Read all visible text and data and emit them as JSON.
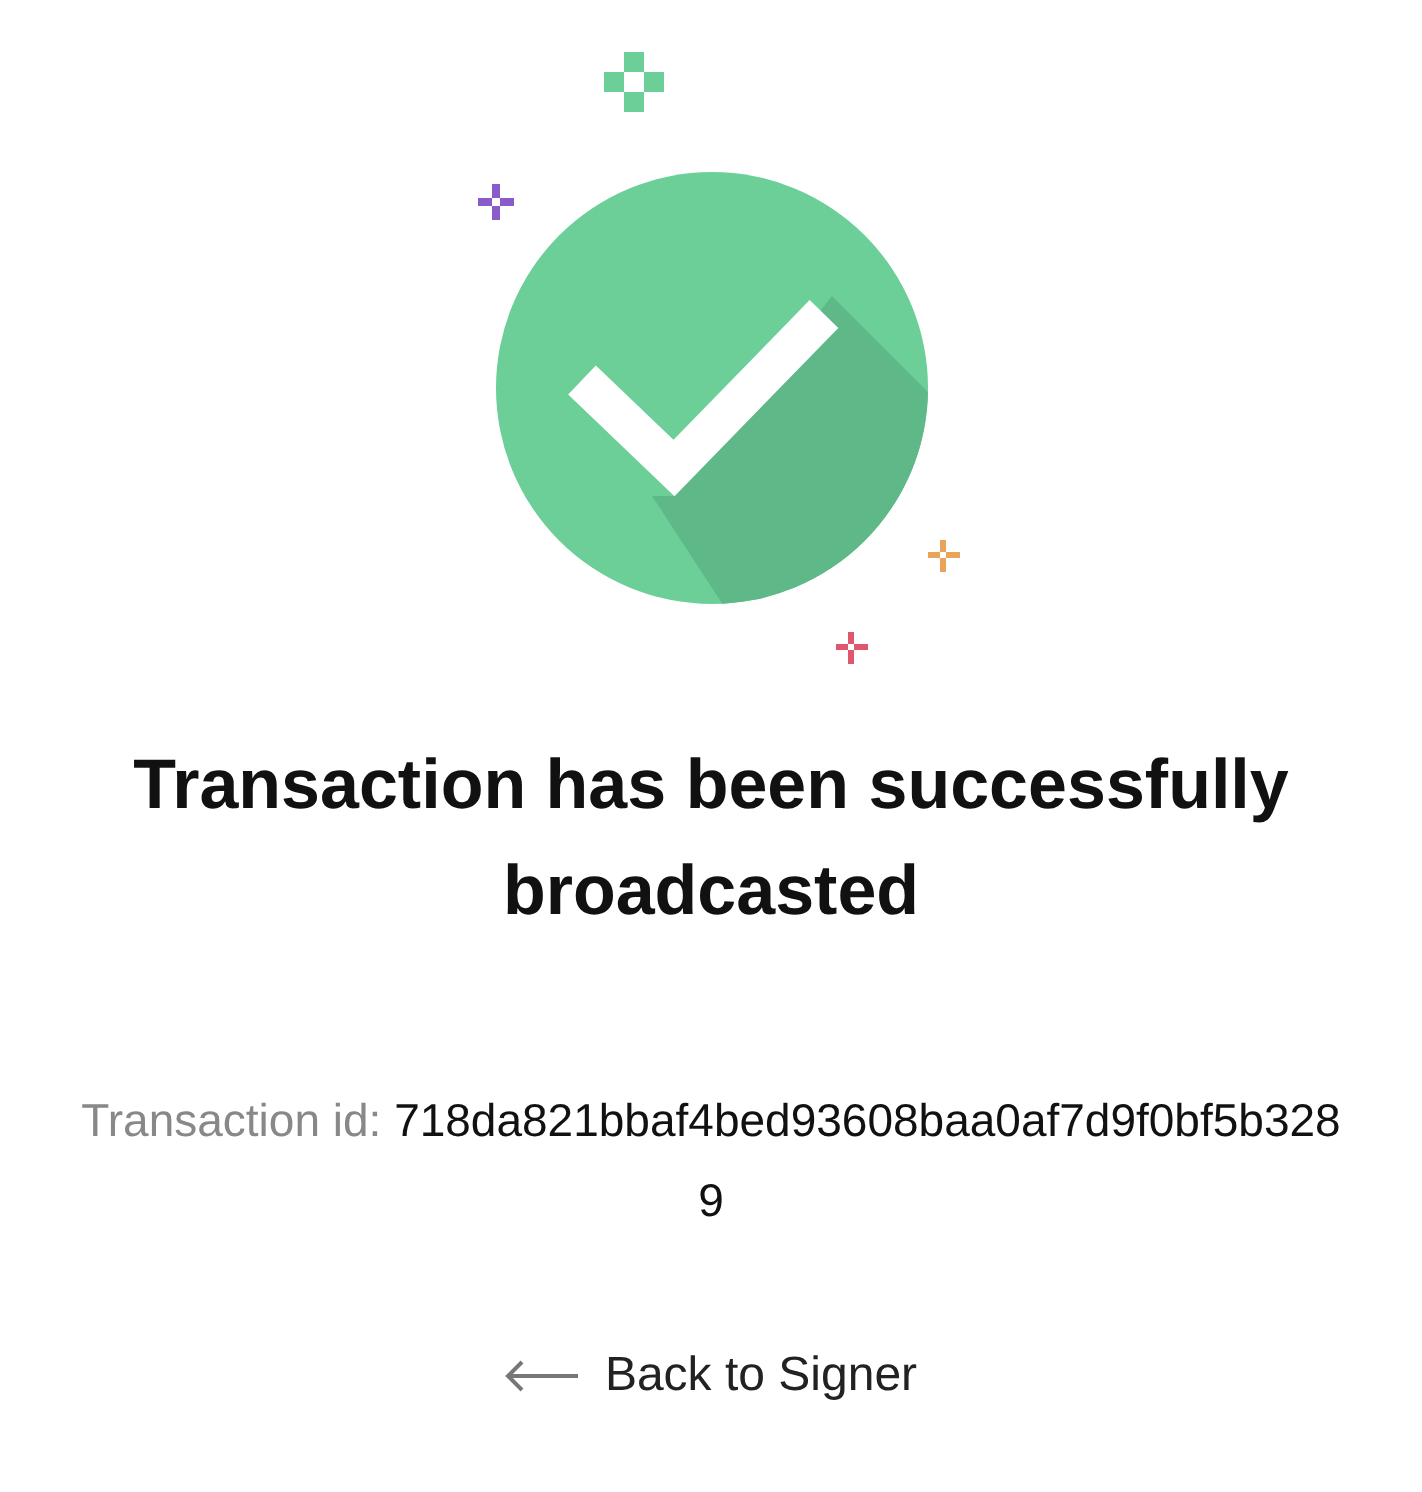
{
  "heading": "Transaction has been successfully broadcasted",
  "transaction": {
    "label": "Transaction id:",
    "value": "718da821bbaf4bed93608baa0af7d9f0bf5b3289"
  },
  "back_link": {
    "label": "Back to Signer"
  }
}
